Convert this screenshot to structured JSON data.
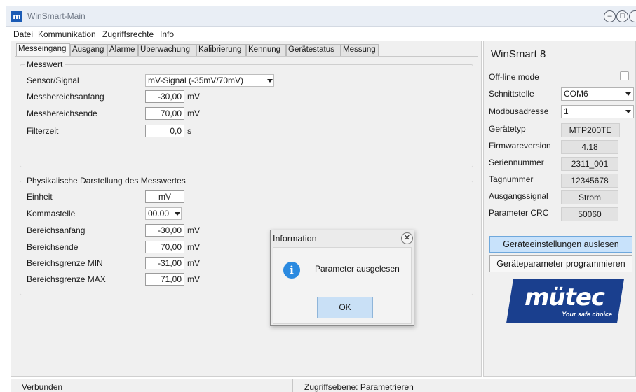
{
  "window": {
    "title": "WinSmart-Main",
    "logo_letter": "m",
    "minimize": "–",
    "restore": "□",
    "close": "✕"
  },
  "menu": [
    "Datei",
    "Kommunikation",
    "Zugriffsrechte",
    "Info"
  ],
  "tabs": [
    "Messeingang",
    "Ausgang",
    "Alarme",
    "Überwachung",
    "Kalibrierung",
    "Kennung",
    "Gerätestatus",
    "Messung"
  ],
  "active_tab": "Messeingang",
  "messwert": {
    "title": "Messwert",
    "sensor_label": "Sensor/Signal",
    "sensor_value": "mV-Signal (-35mV/70mV)",
    "anfang_label": "Messbereichsanfang",
    "anfang_value": "-30,00",
    "anfang_unit": "mV",
    "ende_label": "Messbereichsende",
    "ende_value": "70,00",
    "ende_unit": "mV",
    "filter_label": "Filterzeit",
    "filter_value": "0,0",
    "filter_unit": "s"
  },
  "physik": {
    "title": "Physikalische Darstellung des Messwertes",
    "einheit_label": "Einheit",
    "einheit_value": "mV",
    "komma_label": "Kommastelle",
    "komma_value": "00.00",
    "anfang_label": "Bereichsanfang",
    "anfang_value": "-30,00",
    "anfang_unit": "mV",
    "ende_label": "Bereichsende",
    "ende_value": "70,00",
    "ende_unit": "mV",
    "min_label": "Bereichsgrenze MIN",
    "min_value": "-31,00",
    "min_unit": "mV",
    "max_label": "Bereichsgrenze MAX",
    "max_value": "71,00",
    "max_unit": "mV"
  },
  "side": {
    "title": "WinSmart 8",
    "offline_label": "Off-line mode",
    "schnitt_label": "Schnittstelle",
    "schnitt_value": "COM6",
    "modbus_label": "Modbusadresse",
    "modbus_value": "1",
    "typ_label": "Gerätetyp",
    "typ_value": "MTP200TE",
    "fw_label": "Firmwareversion",
    "fw_value": "4.18",
    "serie_label": "Seriennummer",
    "serie_value": "2311_001",
    "tag_label": "Tagnummer",
    "tag_value": "12345678",
    "ausgang_label": "Ausgangssignal",
    "ausgang_value": "Strom",
    "crc_label": "Parameter CRC",
    "crc_value": "50060",
    "btn_read": "Geräteeinstellungen auslesen",
    "btn_program": "Geräteparameter programmieren",
    "logo_text": "mütec",
    "logo_tagline": "Your safe choice"
  },
  "status": {
    "left": "Verbunden",
    "right": "Zugriffsebene: Parametrieren"
  },
  "dialog": {
    "title": "Information",
    "message": "Parameter ausgelesen",
    "ok": "OK",
    "icon_glyph": "i",
    "close_glyph": "✕"
  }
}
